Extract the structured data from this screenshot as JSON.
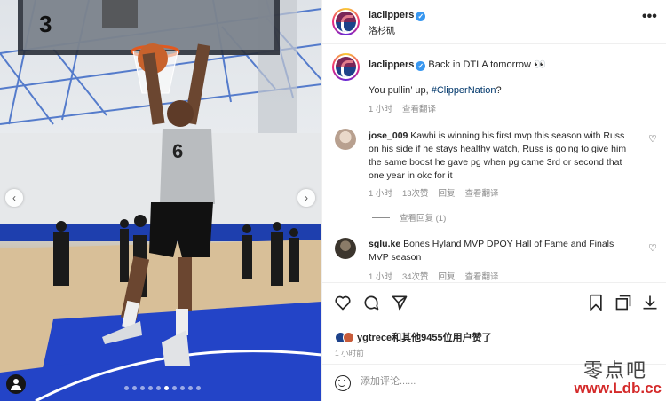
{
  "photo": {
    "jersey_number": "6",
    "backboard_number": "3",
    "prev_icon": "chevron-left-icon",
    "next_icon": "chevron-right-icon",
    "tag_icon": "user-tag-icon",
    "slide_count": 10,
    "active_slide": 6
  },
  "header": {
    "username": "laclippers",
    "location": "洛杉矶",
    "more_icon": "•••"
  },
  "caption": {
    "username": "laclippers",
    "text": "Back in DTLA tomorrow 👀",
    "line2_prefix": "You pullin’ up, ",
    "hashtag": "#ClipperNation",
    "line2_suffix": "?",
    "time": "1 小时",
    "translate": "查看翻译"
  },
  "comments": [
    {
      "username": "jose_009",
      "text": " Kawhi is winning his first mvp this season with Russ on his side if he stays healthy watch, Russ is going to give him the same boost he gave pg when pg came 3rd or second that one year in okc for it",
      "time": "1 小时",
      "likes": "13次赞",
      "reply": "回复",
      "translate": "查看翻译",
      "view_replies": "查看回复 (1)"
    },
    {
      "username": "sglu.ke",
      "text": " Bones Hyland MVP DPOY Hall of Fame and Finals MVP season",
      "time": "1 小时",
      "likes": "34次赞",
      "reply": "回复",
      "translate": "查看翻译"
    }
  ],
  "actions": {
    "like_icon": "heart-icon",
    "comment_icon": "comment-icon",
    "share_icon": "send-icon",
    "save_icon": "bookmark-icon",
    "expand_icon": "expand-icon",
    "download_icon": "download-icon"
  },
  "likes": {
    "text": "ygtrece和其他9455位用户赞了"
  },
  "post_time": "1 小时前",
  "add_comment": {
    "placeholder": "添加评论......"
  },
  "watermark": {
    "chinese": "零点吧",
    "url": "www.Ldb.cc"
  },
  "colors": {
    "text": "#262626",
    "muted": "#8e8e8e",
    "hashtag": "#00376b",
    "verified": "#3897f0",
    "court_blue": "#1d3bbf",
    "watermark_red": "#d42a2a"
  }
}
